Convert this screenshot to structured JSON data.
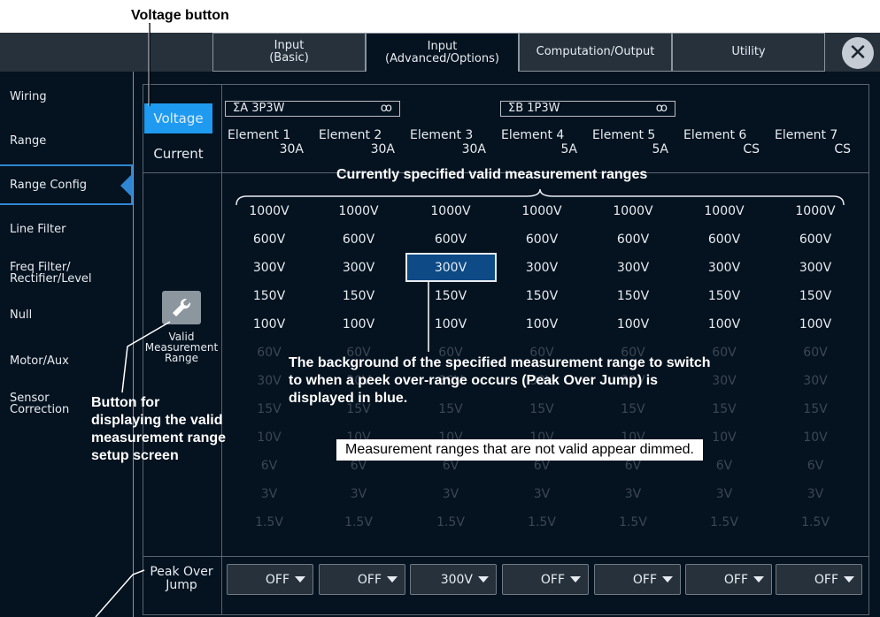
{
  "callouts": {
    "voltage_button": "Voltage button",
    "valid_range_button": [
      "Button for",
      "displaying the valid",
      "measurement range",
      "setup screen"
    ],
    "current_ranges": "Currently specified valid measurement ranges",
    "peak_over_jump": [
      "The background of the specified measurement range to switch",
      "to when a peek over-range occurs (Peak Over Jump) is",
      "displayed in blue."
    ],
    "dimmed_note": "Measurement ranges that are not valid appear dimmed."
  },
  "tabs": [
    {
      "label": "Input\n(Basic)",
      "active": false
    },
    {
      "label": "Input\n(Advanced/Options)",
      "active": true
    },
    {
      "label": "Computation/Output",
      "active": false
    },
    {
      "label": "Utility",
      "active": false
    }
  ],
  "close_icon": "✕",
  "sidebar": [
    {
      "label": "Wiring"
    },
    {
      "label": "Range"
    },
    {
      "label": "Range Config",
      "active": true
    },
    {
      "label": "Line Filter"
    },
    {
      "label": "Freq Filter/\nRectifier/Level"
    },
    {
      "label": "Null"
    },
    {
      "label": "Motor/Aux"
    },
    {
      "label": "Sensor\nCorrection"
    }
  ],
  "mode": {
    "voltage": "Voltage",
    "current": "Current",
    "selected": "voltage"
  },
  "groups": [
    {
      "label": "ΣA  3P3W",
      "link_icon": "ꝏ"
    },
    {
      "label": "ΣB  1P3W",
      "link_icon": "ꝏ"
    }
  ],
  "elements": [
    {
      "name": "Element 1",
      "current": "30A"
    },
    {
      "name": "Element 2",
      "current": "30A"
    },
    {
      "name": "Element 3",
      "current": "30A"
    },
    {
      "name": "Element 4",
      "current": "5A"
    },
    {
      "name": "Element 5",
      "current": "5A"
    },
    {
      "name": "Element 6",
      "current": "CS"
    },
    {
      "name": "Element 7",
      "current": "CS"
    }
  ],
  "ranges": [
    "1000V",
    "600V",
    "300V",
    "150V",
    "100V",
    "60V",
    "30V",
    "15V",
    "10V",
    "6V",
    "3V",
    "1.5V"
  ],
  "valid_count": 5,
  "peak_over_jump_selected": {
    "element": 3,
    "range": "300V"
  },
  "valid_range_button": {
    "label": "Valid\nMeasurement\nRange",
    "icon": "wrench-icon"
  },
  "peak_over_jump": {
    "label": "Peak Over\nJump",
    "values": [
      "OFF",
      "OFF",
      "300V",
      "OFF",
      "OFF",
      "OFF",
      "OFF"
    ]
  },
  "colors": {
    "background": "#05121f",
    "accent_blue": "#1e9bf0",
    "highlight": "#2f86d4"
  }
}
